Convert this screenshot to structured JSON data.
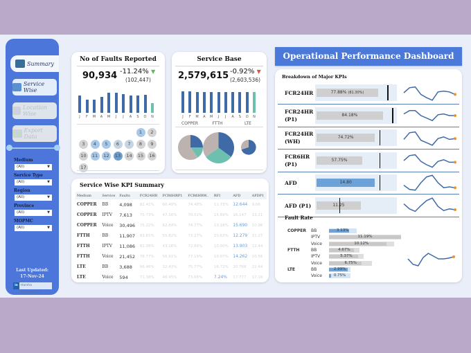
{
  "title": "Operational Performance Dashboard",
  "nav": [
    {
      "label": "Summary",
      "active": true
    },
    {
      "label": "Service Wise",
      "active": false
    },
    {
      "label": "Location Wise",
      "active": false
    },
    {
      "label": "Export Data",
      "active": false
    }
  ],
  "filters": [
    {
      "label": "Medium",
      "value": "(All)"
    },
    {
      "label": "Service Type",
      "value": "(All)"
    },
    {
      "label": "Region",
      "value": "(All)"
    },
    {
      "label": "Province",
      "value": "(All)"
    },
    {
      "label": "MOPMC",
      "value": "(All)"
    }
  ],
  "last_updated_label": "Last Updated:",
  "last_updated": "17-Nov-24",
  "author": "Harsha Jayasundara",
  "faults": {
    "title": "No of Faults Reported",
    "value": "90,934",
    "change": "-11.24%",
    "previous": "(102,447)",
    "trend_color": "#5cb85c",
    "months": [
      "J",
      "F",
      "M",
      "A",
      "M",
      "J",
      "J",
      "A",
      "S",
      "O",
      "N"
    ],
    "monthly_relative": [
      0.78,
      0.6,
      0.6,
      0.72,
      0.9,
      0.9,
      0.83,
      0.78,
      0.78,
      0.8,
      0.45
    ],
    "days": [
      {
        "d": "1",
        "level": 2
      },
      {
        "d": "2",
        "level": 0
      },
      {
        "d": "3",
        "level": 0
      },
      {
        "d": "4",
        "level": 2
      },
      {
        "d": "5",
        "level": 2
      },
      {
        "d": "6",
        "level": 1
      },
      {
        "d": "7",
        "level": 1
      },
      {
        "d": "8",
        "level": 0
      },
      {
        "d": "9",
        "level": 0
      },
      {
        "d": "10",
        "level": 0
      },
      {
        "d": "11",
        "level": 2
      },
      {
        "d": "12",
        "level": 2
      },
      {
        "d": "13",
        "level": 3
      },
      {
        "d": "14",
        "level": 0
      },
      {
        "d": "15",
        "level": 0
      },
      {
        "d": "16",
        "level": 0
      },
      {
        "d": "17",
        "level": 0
      }
    ]
  },
  "service_base": {
    "title": "Service Base",
    "value": "2,579,615",
    "change": "-0.92%",
    "previous": "(2,603,536)",
    "trend_color": "#d9534f",
    "months": [
      "J",
      "F",
      "M",
      "A",
      "M",
      "J",
      "J",
      "A",
      "S",
      "O",
      "N"
    ],
    "monthly_relative": [
      0.97,
      0.97,
      0.95,
      0.94,
      0.94,
      0.94,
      0.94,
      0.94,
      0.93,
      0.93,
      0.93
    ],
    "pies": [
      {
        "label": "COPPER",
        "slices": [
          25,
          15,
          60
        ],
        "size": 1
      },
      {
        "label": "FTTH",
        "slices": [
          35,
          30,
          35
        ],
        "size": 1.25
      },
      {
        "label": "LTE",
        "slices": [
          70,
          0,
          30
        ],
        "size": 0.6
      }
    ]
  },
  "kpi_summary": {
    "title": "Service Wise KPI Summary",
    "columns": [
      "Medium",
      "Service",
      "Faults",
      "FCR24HR",
      "FCR6HRP1",
      "FCR6HRW..",
      "RFI",
      "AFD",
      "AFDP1"
    ],
    "rows": [
      [
        "COPPER",
        "BB",
        "4,098",
        "82.41%",
        "60.49%",
        "74.48%",
        "11.73%",
        "12.644",
        "9.66"
      ],
      [
        "COPPER",
        "IPTV",
        "7,613",
        "75.73%",
        "47.16%",
        "70.01%",
        "15.69%",
        "16.147",
        "13.21"
      ],
      [
        "COPPER",
        "Voice",
        "30,496",
        "75.22%",
        "62.84%",
        "74.77%",
        "13.18%",
        "15.690",
        "10.96"
      ],
      [
        "FTTH",
        "BB",
        "11,907",
        "83.81%",
        "55.82%",
        "73.27%",
        "10.63%",
        "12.279",
        "11.27"
      ],
      [
        "FTTH",
        "IPTV",
        "11,086",
        "81.08%",
        "43.16%",
        "72.84%",
        "10.00%",
        "13.903",
        "12.44"
      ],
      [
        "FTTH",
        "Voice",
        "21,452",
        "78.77%",
        "56.91%",
        "77.19%",
        "10.07%",
        "14.262",
        "10.56"
      ],
      [
        "LTE",
        "BB",
        "3,688",
        "66.46%",
        "32.43%",
        "75.77%",
        "16.72%",
        "20.768",
        "22.44"
      ],
      [
        "LTE",
        "Voice",
        "594",
        "71.38%",
        "46.45%",
        "73.66%",
        "7.24%",
        "17.777",
        "17.10"
      ]
    ],
    "highlight": [
      [
        0,
        7
      ],
      [
        2,
        7
      ],
      [
        3,
        7
      ],
      [
        4,
        7
      ],
      [
        5,
        7
      ],
      [
        7,
        6
      ]
    ]
  },
  "breakdown": {
    "title": "Breakdown of Major KPIs",
    "rows": [
      {
        "label": [
          "FCR24HR"
        ],
        "value": "77.88%",
        "extra": "(81.30%)",
        "fill": 0.78,
        "target": 0.9,
        "highlight": false,
        "spark": [
          0.5,
          0.8,
          0.85,
          0.4,
          0.2,
          0.05,
          0.55,
          0.6,
          0.55,
          0.4
        ]
      },
      {
        "label": [
          "FCR24HR",
          "(P1)"
        ],
        "value": "84.18%",
        "extra": "",
        "fill": 0.84,
        "target": 0.96,
        "highlight": false,
        "spark": [
          0.6,
          0.8,
          0.8,
          0.5,
          0.35,
          0.2,
          0.55,
          0.6,
          0.5,
          0.5
        ]
      },
      {
        "label": [
          "FCR24HR",
          "(WH)"
        ],
        "value": "74.72%",
        "extra": "",
        "fill": 0.74,
        "target": 0.8,
        "highlight": false,
        "spark": [
          0.4,
          0.8,
          0.85,
          0.35,
          0.2,
          0.05,
          0.45,
          0.55,
          0.4,
          0.45
        ]
      },
      {
        "label": [
          "FCR6HR",
          "(P1)"
        ],
        "value": "57.75%",
        "extra": "",
        "fill": 0.58,
        "target": 0.8,
        "highlight": false,
        "spark": [
          0.5,
          0.8,
          0.85,
          0.45,
          0.25,
          0.1,
          0.45,
          0.55,
          0.4,
          0.4
        ]
      },
      {
        "label": [
          "AFD"
        ],
        "value": "14.80",
        "extra": "",
        "fill": 0.74,
        "target": 0.8,
        "highlight": true,
        "spark": [
          0.35,
          0.1,
          0.05,
          0.5,
          0.85,
          0.95,
          0.5,
          0.2,
          0.25,
          0.2
        ]
      },
      {
        "label": [
          "AFD (P1)"
        ],
        "value": "11.25",
        "extra": "",
        "fill": 0.56,
        "target": 0.3,
        "highlight": false,
        "spark": [
          0.6,
          0.3,
          0.15,
          0.5,
          0.8,
          0.95,
          0.45,
          0.2,
          0.3,
          0.25
        ]
      }
    ]
  },
  "fault_rate": {
    "title": "Fault Rate",
    "rows": [
      {
        "medium": "COPPER",
        "service": "BB",
        "value": "3.13%",
        "fill": 0.28,
        "track": 0.38,
        "highlight": true
      },
      {
        "medium": "",
        "service": "IPTV",
        "value": "11.19%",
        "fill": 1.0,
        "track": 1.0,
        "highlight": false
      },
      {
        "medium": "",
        "service": "Voice",
        "value": "10.12%",
        "fill": 0.8,
        "track": 0.9,
        "highlight": false
      },
      {
        "medium": "FTTH",
        "service": "BB",
        "value": "4.67%",
        "fill": 0.35,
        "track": 0.42,
        "highlight": false
      },
      {
        "medium": "",
        "service": "IPTV",
        "value": "5.37%",
        "fill": 0.4,
        "track": 0.48,
        "highlight": false
      },
      {
        "medium": "",
        "service": "Voice",
        "value": "6.75%",
        "fill": 0.45,
        "track": 0.6,
        "highlight": false
      },
      {
        "medium": "LTE",
        "service": "BB",
        "value": "2.99%",
        "fill": 0.26,
        "track": 0.3,
        "highlight": true
      },
      {
        "medium": "",
        "service": "Voice",
        "value": "0.75%",
        "fill": 0.03,
        "track": 0.3,
        "highlight": true
      }
    ],
    "spark": [
      0.5,
      0.1,
      0.0,
      0.6,
      0.9,
      0.7,
      0.5,
      0.5,
      0.55,
      0.65
    ]
  },
  "colors": {
    "sidebar": "#4c76d9",
    "bar": "#3f6aa6",
    "bar_current": "#6dbfae",
    "pie_blue": "#3f6aa6",
    "pie_teal": "#6dbfae",
    "pie_grey": "#bcb3b0",
    "highlight": "#6ca2d8",
    "spark": "#3f6aa6",
    "spark_end": "#f0902a"
  }
}
